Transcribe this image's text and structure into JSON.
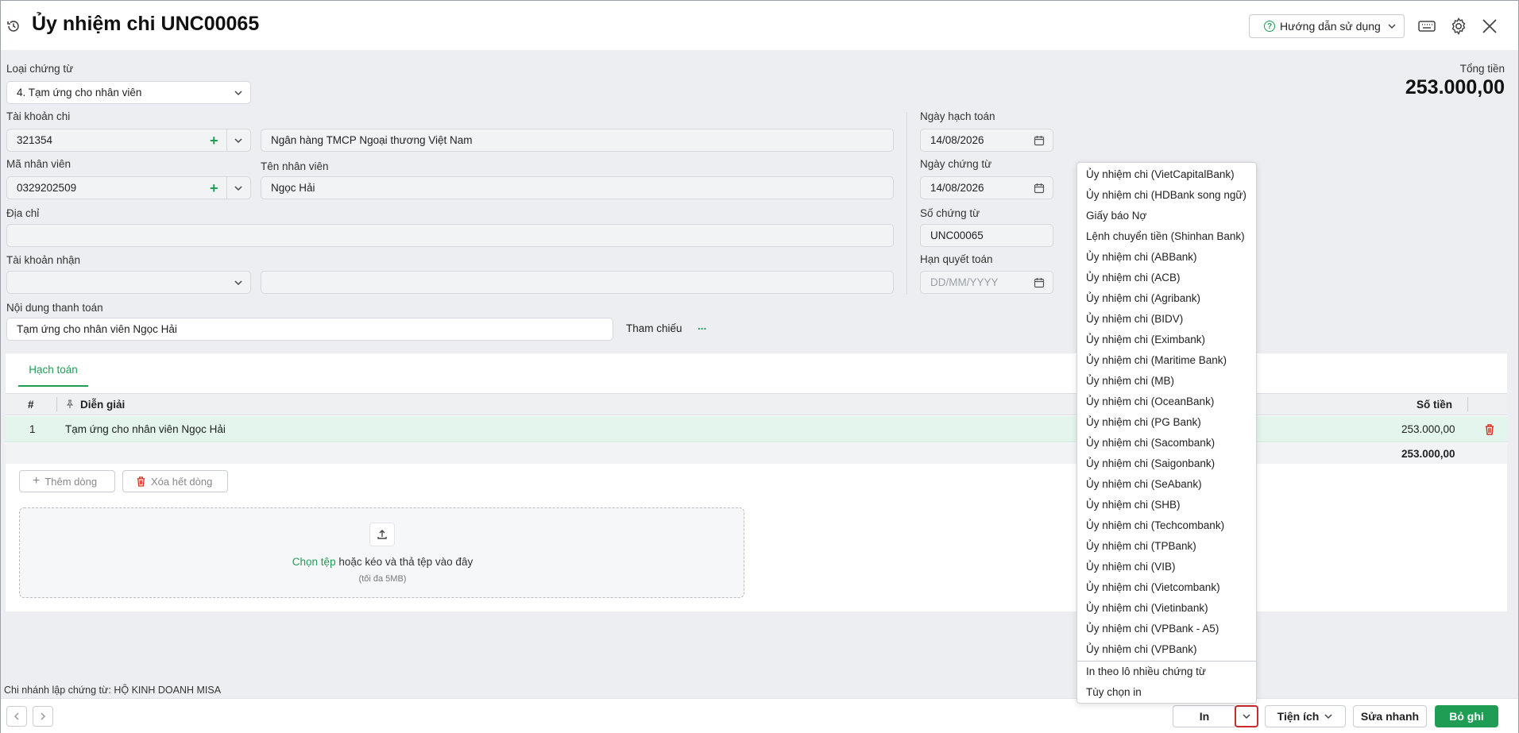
{
  "header": {
    "title": "Ủy nhiệm chi UNC00065",
    "help_label": "Hướng dẫn sử dụng"
  },
  "form": {
    "voucher_type_label": "Loại chứng từ",
    "voucher_type_value": "4. Tạm ứng cho nhân viên",
    "pay_account_label": "Tài khoản chi",
    "pay_account_value": "321354",
    "bank_name_value": "Ngân hàng TMCP Ngoại thương Việt Nam",
    "employee_code_label": "Mã nhân viên",
    "employee_code_value": "0329202509",
    "employee_name_label": "Tên nhân viên",
    "employee_name_value": "Ngọc Hải",
    "address_label": "Địa chỉ",
    "address_value": "",
    "receive_account_label": "Tài khoản nhận",
    "receive_account_value": "",
    "receive_bank_value": "",
    "content_label": "Nội dung thanh toán",
    "content_value": "Tạm ứng cho nhân viên Ngọc Hải",
    "reference_label": "Tham chiếu",
    "reference_more": "...",
    "posting_date_label": "Ngày hạch toán",
    "posting_date_value": "14/08/2026",
    "voucher_date_label": "Ngày chứng từ",
    "voucher_date_value": "14/08/2026",
    "voucher_no_label": "Số chứng từ",
    "voucher_no_value": "UNC00065",
    "due_date_label": "Hạn quyết toán",
    "due_date_placeholder": "DD/MM/YYYY",
    "total_label": "Tổng tiền",
    "total_value": "253.000,00"
  },
  "grid": {
    "tab_label": "Hạch toán",
    "columns": {
      "index": "#",
      "description": "Diễn giải",
      "amount": "Số tiền"
    },
    "rows": [
      {
        "index": "1",
        "description": "Tạm ứng cho nhân viên Ngọc Hải",
        "amount": "253.000,00"
      }
    ],
    "footer_total": "253.000,00",
    "add_row_label": "Thêm dòng",
    "delete_all_label": "Xóa hết dòng"
  },
  "upload": {
    "choose_label": "Chọn tệp",
    "drag_text": " hoặc kéo và thả tệp vào đây",
    "limit_text": "(tối đa 5MB)"
  },
  "branch_text": "Chi nhánh lập chứng từ: HỘ KINH DOANH MISA",
  "bottom": {
    "print_label": "In",
    "utility_label": "Tiện ích",
    "quick_edit_label": "Sửa nhanh",
    "discard_label": "Bỏ ghi"
  },
  "print_menu": {
    "items": [
      "Ủy nhiệm chi (VietCapitalBank)",
      "Ủy nhiệm chi (HDBank song ngữ)",
      "Giấy báo Nợ",
      "Lệnh chuyển tiền (Shinhan Bank)",
      "Ủy nhiệm chi (ABBank)",
      "Ủy nhiệm chi (ACB)",
      "Ủy nhiệm chi (Agribank)",
      "Ủy nhiệm chi (BIDV)",
      "Ủy nhiệm chi (Eximbank)",
      "Ủy nhiệm chi (Maritime Bank)",
      "Ủy nhiệm chi (MB)",
      "Ủy nhiệm chi (OceanBank)",
      "Ủy nhiệm chi (PG Bank)",
      "Ủy nhiệm chi (Sacombank)",
      "Ủy nhiệm chi (Saigonbank)",
      "Ủy nhiệm chi (SeAbank)",
      "Ủy nhiệm chi (SHB)",
      "Ủy nhiệm chi (Techcombank)",
      "Ủy nhiệm chi (TPBank)",
      "Ủy nhiệm chi (VIB)",
      "Ủy nhiệm chi (Vietcombank)",
      "Ủy nhiệm chi (Vietinbank)",
      "Ủy nhiệm chi (VPBank - A5)",
      "Ủy nhiệm chi (VPBank)"
    ],
    "extra_items": [
      "In theo lô nhiều chứng từ",
      "Tùy chọn in"
    ]
  },
  "colors": {
    "accent": "#1f9d55",
    "danger": "#d93025"
  }
}
